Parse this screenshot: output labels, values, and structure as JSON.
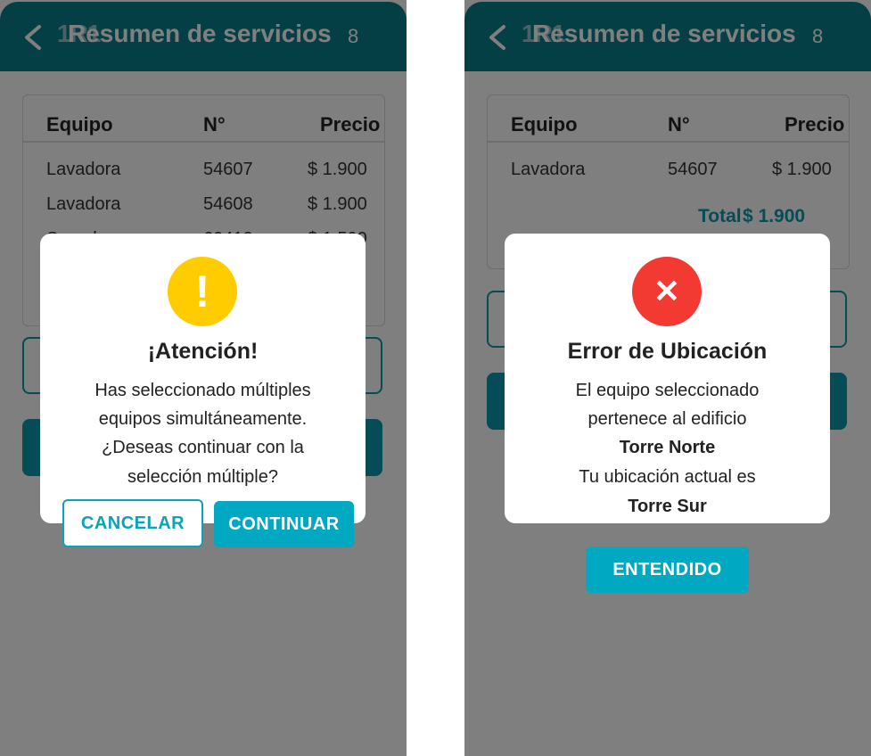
{
  "screens": [
    {
      "header": {
        "title_code": "1R1",
        "title": "Resumen de servicios",
        "count": "8"
      },
      "table": {
        "headers": [
          "Equipo",
          "N°",
          "Precio"
        ],
        "rows": [
          [
            "Lavadora",
            "54607",
            "$ 1.900"
          ],
          [
            "Lavadora",
            "54608",
            "$ 1.900"
          ],
          [
            "Secadora",
            "60412",
            "$ 1.500"
          ]
        ]
      },
      "dialog": {
        "icon": "exclamation-icon",
        "icon_glyph": "!",
        "icon_color": "#ffcc00",
        "title": "¡Atención!",
        "lines": [
          "Has seleccionado múltiples",
          "equipos simultáneamente.",
          "¿Deseas continuar con la",
          "selección múltiple?"
        ],
        "cancel_label": "CANCELAR",
        "continue_label": "CONTINUAR"
      }
    },
    {
      "header": {
        "title_code": "1R1",
        "title": "Resumen de servicios",
        "count": "8"
      },
      "table": {
        "headers": [
          "Equipo",
          "N°",
          "Precio"
        ],
        "rows": [
          [
            "Lavadora",
            "54607",
            "$ 1.900"
          ]
        ],
        "total_label": "Total",
        "total_value": "$ 1.900"
      },
      "dialog": {
        "icon": "close-icon",
        "icon_glyph": "✕",
        "icon_color": "#f23a33",
        "title": "Error de Ubicación",
        "line1": "El equipo seleccionado",
        "line2": "pertenece al edificio",
        "building": "Torre Norte",
        "line3": "Tu ubicación actual es",
        "location": "Torre Sur",
        "ok_label": "ENTENDIDO"
      }
    }
  ],
  "colors": {
    "header": "#0a7f8c",
    "accent": "#00a8c2",
    "total": "#0a98ad"
  }
}
